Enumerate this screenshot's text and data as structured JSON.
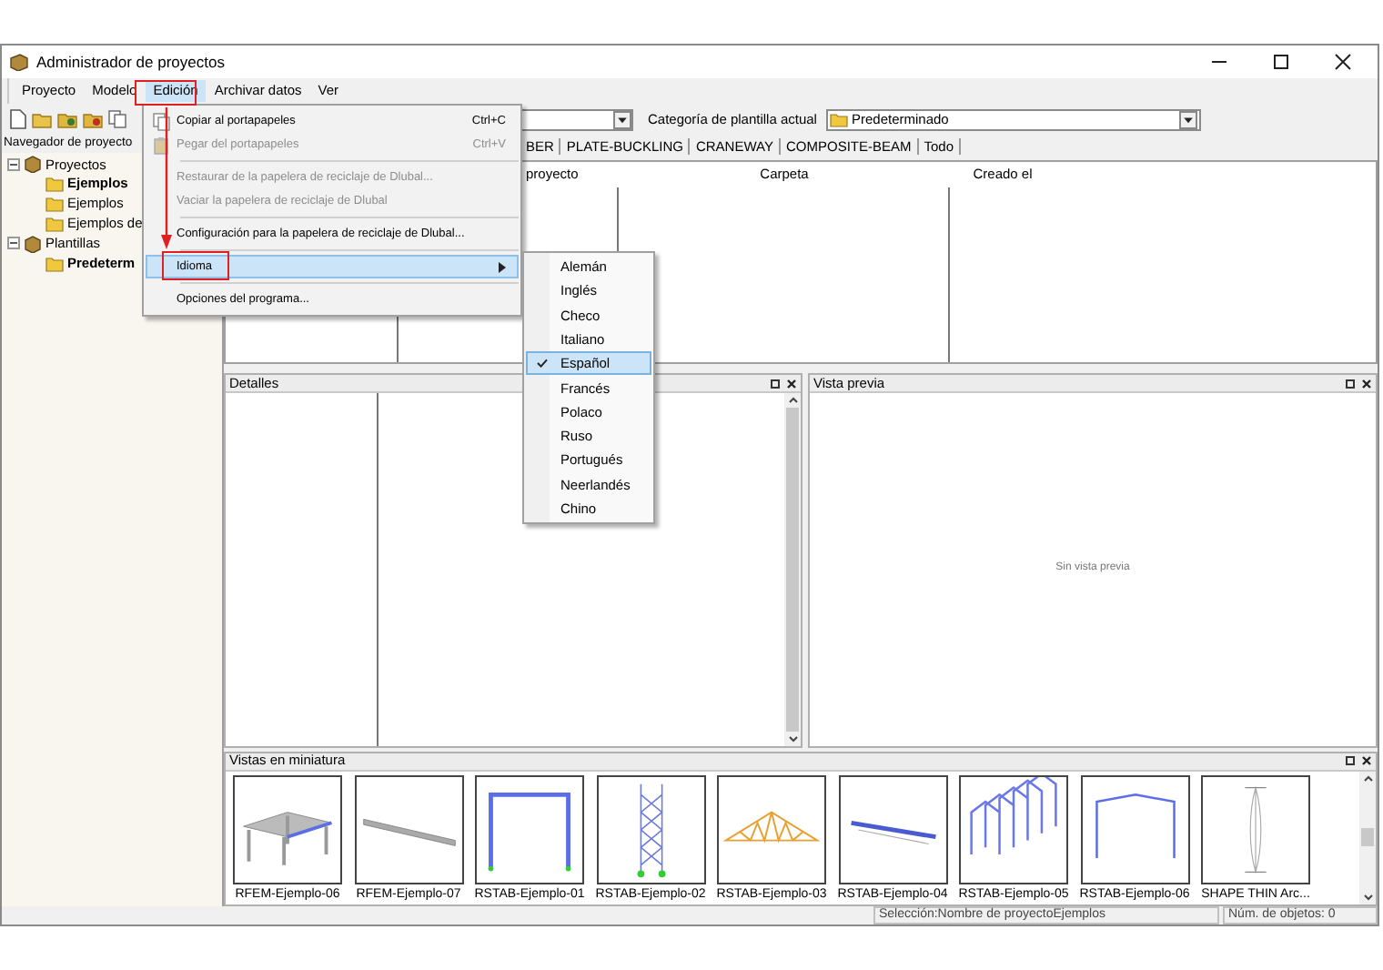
{
  "window": {
    "title": "Administrador de proyectos"
  },
  "menu_bar": [
    {
      "label": "Proyecto",
      "selected": false
    },
    {
      "label": "Modelo",
      "selected": false
    },
    {
      "label": "Edición",
      "selected": true
    },
    {
      "label": "Archivar datos",
      "selected": false
    },
    {
      "label": "Ver",
      "selected": false
    }
  ],
  "toolbar": {
    "category_label": "Categoría de plantilla actual",
    "category_value": "Predeterminado"
  },
  "navigator": {
    "title": "Navegador de proyecto",
    "tree": [
      {
        "label": "Proyectos",
        "kind": "group",
        "expanded": true,
        "active": false,
        "children": [
          {
            "label": "Ejemplos",
            "kind": "folder",
            "active": true
          },
          {
            "label": "Ejemplos",
            "kind": "folder",
            "active": false
          },
          {
            "label": "Ejemplos de",
            "kind": "folder",
            "active": false
          }
        ]
      },
      {
        "label": "Plantillas",
        "kind": "group",
        "expanded": true,
        "active": false,
        "children": [
          {
            "label": "Predeterm",
            "kind": "folder",
            "active": true
          }
        ]
      }
    ]
  },
  "filter_tabs": [
    {
      "label": "BER"
    },
    {
      "label": "PLATE-BUCKLING"
    },
    {
      "label": "CRANEWAY"
    },
    {
      "label": "COMPOSITE-BEAM"
    },
    {
      "label": "Todo"
    }
  ],
  "table": {
    "columns": [
      "proyecto",
      "Carpeta",
      "Creado el"
    ]
  },
  "edit_menu": [
    {
      "kind": "item",
      "label": "Copiar al portapapeles",
      "shortcut": "Ctrl+C",
      "disabled": false,
      "selected": false
    },
    {
      "kind": "item",
      "label": "Pegar del portapapeles",
      "shortcut": "Ctrl+V",
      "disabled": true,
      "selected": false
    },
    {
      "kind": "separator"
    },
    {
      "kind": "item",
      "label": "Restaurar de la papelera de reciclaje de Dlubal...",
      "disabled": true,
      "selected": false
    },
    {
      "kind": "item",
      "label": "Vaciar la papelera de reciclaje de Dlubal",
      "disabled": true,
      "selected": false
    },
    {
      "kind": "separator"
    },
    {
      "kind": "item",
      "label": "Configuración para la papelera de reciclaje de Dlubal...",
      "disabled": false,
      "selected": false
    },
    {
      "kind": "separator"
    },
    {
      "kind": "item",
      "label": "Idioma",
      "disabled": false,
      "selected": true,
      "submenu": true
    },
    {
      "kind": "separator"
    },
    {
      "kind": "item",
      "label": "Opciones del programa...",
      "disabled": false,
      "selected": false
    }
  ],
  "language_menu": [
    {
      "label": "Alemán",
      "checked": false,
      "selected": false
    },
    {
      "label": "Inglés",
      "checked": false,
      "selected": false
    },
    {
      "label": "Checo",
      "checked": false,
      "selected": false
    },
    {
      "label": "Italiano",
      "checked": false,
      "selected": false
    },
    {
      "label": "Español",
      "checked": true,
      "selected": true
    },
    {
      "label": "Francés",
      "checked": false,
      "selected": false
    },
    {
      "label": "Polaco",
      "checked": false,
      "selected": false
    },
    {
      "label": "Ruso",
      "checked": false,
      "selected": false
    },
    {
      "label": "Portugués",
      "checked": false,
      "selected": false
    },
    {
      "label": "Neerlandés",
      "checked": false,
      "selected": false
    },
    {
      "label": "Chino",
      "checked": false,
      "selected": false
    }
  ],
  "details": {
    "title": "Detalles"
  },
  "preview": {
    "title": "Vista previa",
    "message": "Sin vista previa"
  },
  "thumbnails": {
    "title": "Vistas en miniatura",
    "items": [
      {
        "caption": "RFEM-Ejemplo-06",
        "kind": "slab"
      },
      {
        "caption": "RFEM-Ejemplo-07",
        "kind": "beam"
      },
      {
        "caption": "RSTAB-Ejemplo-01",
        "kind": "portal"
      },
      {
        "caption": "RSTAB-Ejemplo-02",
        "kind": "tower"
      },
      {
        "caption": "RSTAB-Ejemplo-03",
        "kind": "truss"
      },
      {
        "caption": "RSTAB-Ejemplo-04",
        "kind": "girder"
      },
      {
        "caption": "RSTAB-Ejemplo-05",
        "kind": "hall"
      },
      {
        "caption": "RSTAB-Ejemplo-06",
        "kind": "gable"
      },
      {
        "caption": "SHAPE THIN Arc...",
        "kind": "section"
      }
    ]
  },
  "status_bar": {
    "selection": "Selección:Nombre de proyectoEjemplos",
    "count": "Núm. de objetos: 0"
  }
}
